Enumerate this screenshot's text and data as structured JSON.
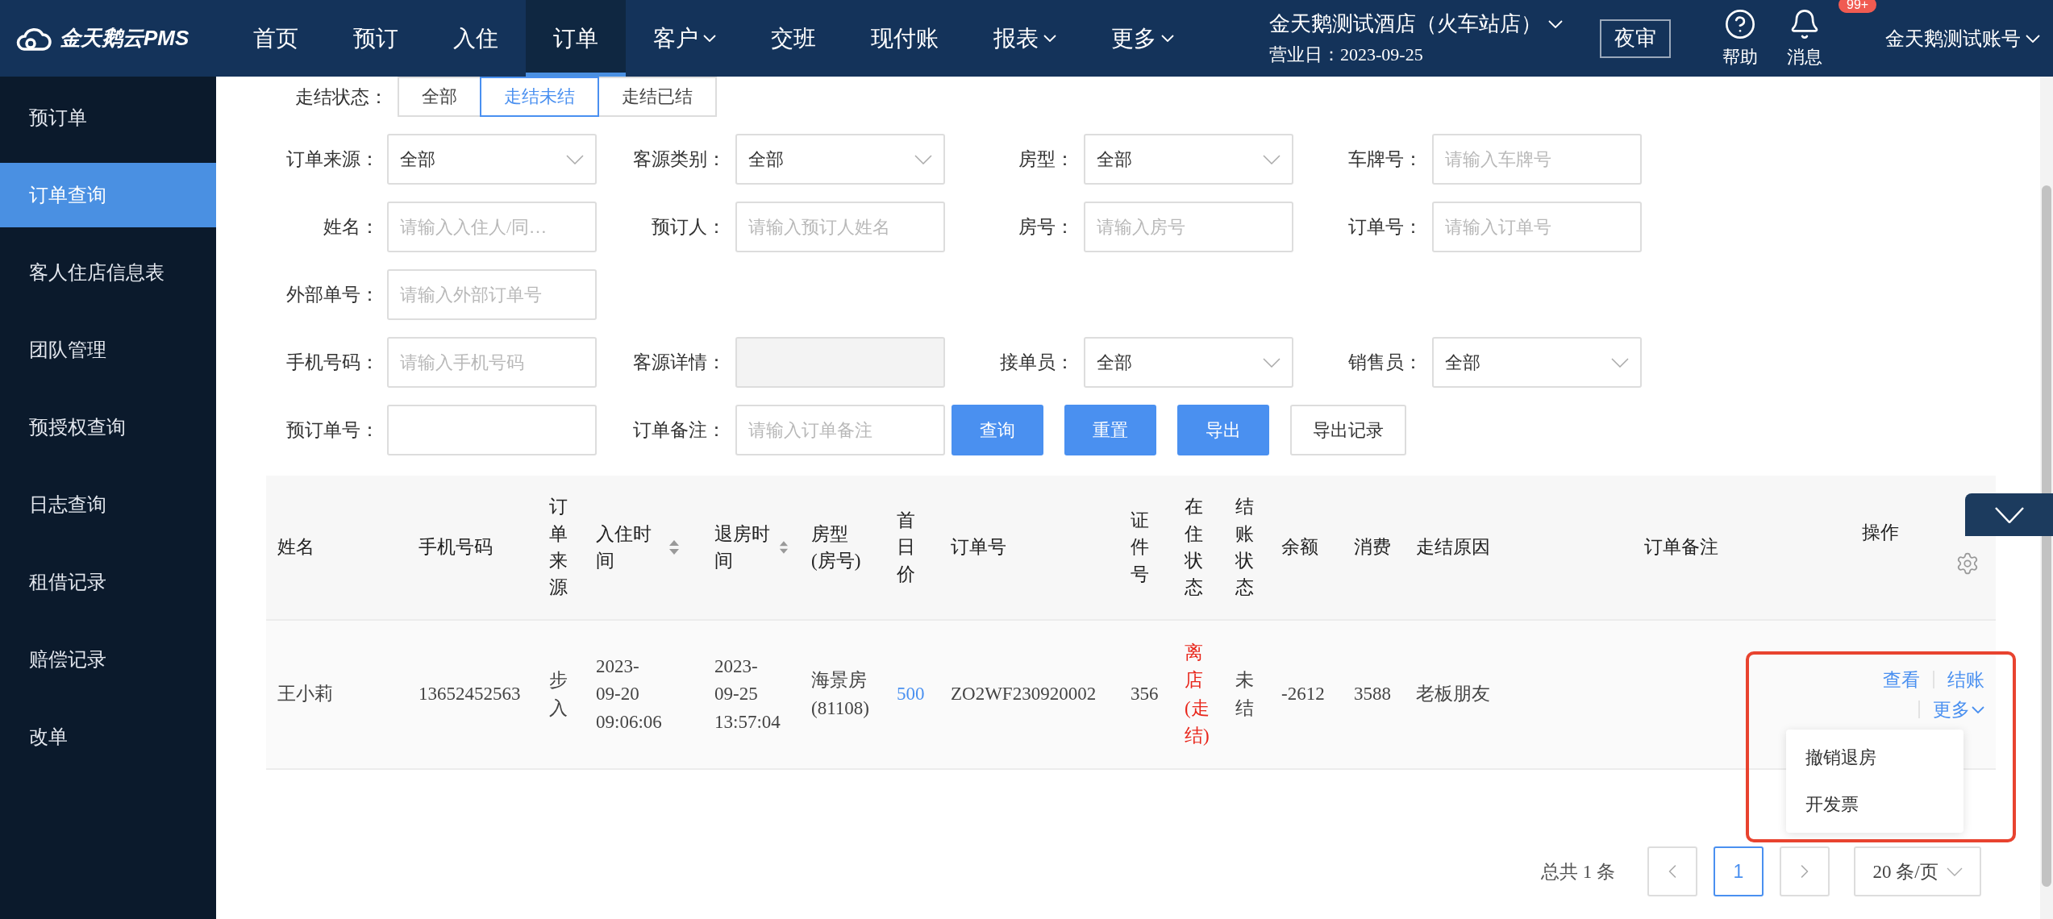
{
  "topbar": {
    "logo": "金天鹅云PMS",
    "nav": [
      {
        "label": "首页",
        "selected": false,
        "dropdown": false
      },
      {
        "label": "预订",
        "selected": false,
        "dropdown": false
      },
      {
        "label": "入住",
        "selected": false,
        "dropdown": false
      },
      {
        "label": "订单",
        "selected": true,
        "dropdown": false
      },
      {
        "label": "客户",
        "selected": false,
        "dropdown": true
      },
      {
        "label": "交班",
        "selected": false,
        "dropdown": false
      },
      {
        "label": "现付账",
        "selected": false,
        "dropdown": false
      },
      {
        "label": "报表",
        "selected": false,
        "dropdown": true
      },
      {
        "label": "更多",
        "selected": false,
        "dropdown": true
      }
    ],
    "hotel": {
      "name": "金天鹅测试酒店（火车站店）",
      "business_day": "营业日：2023-09-25"
    },
    "audit_button": "夜审",
    "help": "帮助",
    "messages": {
      "label": "消息",
      "badge": "99+"
    },
    "account": "金天鹅测试账号"
  },
  "sidebar": {
    "items": [
      {
        "label": "预订单",
        "selected": false
      },
      {
        "label": "订单查询",
        "selected": true
      },
      {
        "label": "客人住店信息表",
        "selected": false
      },
      {
        "label": "团队管理",
        "selected": false
      },
      {
        "label": "预授权查询",
        "selected": false
      },
      {
        "label": "日志查询",
        "selected": false
      },
      {
        "label": "租借记录",
        "selected": false
      },
      {
        "label": "赔偿记录",
        "selected": false
      },
      {
        "label": "改单",
        "selected": false
      }
    ]
  },
  "filters": {
    "status": {
      "label": "走结状态：",
      "options": [
        {
          "label": "全部",
          "selected": false
        },
        {
          "label": "走结未结",
          "selected": true
        },
        {
          "label": "走结已结",
          "selected": false
        }
      ]
    },
    "rows": [
      {
        "fields": [
          {
            "label": "订单来源：",
            "kind": "select",
            "value": "全部",
            "disabled": false
          },
          {
            "label": "客源类别：",
            "kind": "select",
            "value": "全部",
            "disabled": false
          },
          {
            "label": "房型：",
            "kind": "select",
            "value": "全部",
            "disabled": false
          },
          {
            "label": "车牌号：",
            "kind": "input",
            "placeholder": "请输入车牌号",
            "disabled": false
          }
        ]
      },
      {
        "fields": [
          {
            "label": "姓名：",
            "kind": "input",
            "placeholder": "请输入入住人/同…",
            "disabled": false
          },
          {
            "label": "预订人：",
            "kind": "input",
            "placeholder": "请输入预订人姓名",
            "disabled": false
          },
          {
            "label": "房号：",
            "kind": "input",
            "placeholder": "请输入房号",
            "disabled": false
          },
          {
            "label": "订单号：",
            "kind": "input",
            "placeholder": "请输入订单号",
            "disabled": false
          }
        ]
      },
      {
        "fields": [
          {
            "label": "外部单号：",
            "kind": "input",
            "placeholder": "请输入外部订单号",
            "disabled": false
          }
        ]
      },
      {
        "fields": [
          {
            "label": "手机号码：",
            "kind": "input",
            "placeholder": "请输入手机号码",
            "disabled": false
          },
          {
            "label": "客源详情：",
            "kind": "input",
            "disabled": true
          },
          {
            "label": "接单员：",
            "kind": "select",
            "value": "全部",
            "disabled": false
          },
          {
            "label": "销售员：",
            "kind": "select",
            "value": "全部",
            "disabled": false
          }
        ]
      },
      {
        "fields": [
          {
            "label": "预订单号：",
            "kind": "input",
            "disabled": false
          },
          {
            "label": "订单备注：",
            "kind": "input",
            "placeholder": "请输入订单备注",
            "disabled": false
          }
        ],
        "actions": [
          {
            "label": "查询",
            "kind": "primary"
          },
          {
            "label": "重置",
            "kind": "primary"
          },
          {
            "label": "导出",
            "kind": "primary"
          },
          {
            "label": "导出记录",
            "kind": "default"
          }
        ]
      }
    ]
  },
  "table": {
    "columns": [
      {
        "label": "姓名",
        "sortable": false
      },
      {
        "label": "手机号码",
        "sortable": false
      },
      {
        "label": "订单来源",
        "sortable": false
      },
      {
        "label": "入住时间",
        "sortable": true
      },
      {
        "label": "退房时间",
        "sortable": true
      },
      {
        "label": "房型(房号)",
        "sortable": false
      },
      {
        "label": "首日价",
        "sortable": false
      },
      {
        "label": "订单号",
        "sortable": false
      },
      {
        "label": "证件号",
        "sortable": false
      },
      {
        "label": "在住状态",
        "sortable": false
      },
      {
        "label": "结账状态",
        "sortable": false
      },
      {
        "label": "余额",
        "sortable": false
      },
      {
        "label": "消费",
        "sortable": false
      },
      {
        "label": "走结原因",
        "sortable": false
      },
      {
        "label": "订单备注",
        "sortable": false
      },
      {
        "label": "操作",
        "sortable": false
      }
    ],
    "rows": [
      {
        "cells": [
          {
            "text": "王小莉",
            "kind": "text"
          },
          {
            "text": "13652452563",
            "kind": "text"
          },
          {
            "text": "步入",
            "kind": "text"
          },
          {
            "text": "2023-09-20 09:06:06",
            "kind": "text"
          },
          {
            "text": "2023-09-25 13:57:04",
            "kind": "text"
          },
          {
            "text": "海景房(81108)",
            "kind": "text"
          },
          {
            "text": "500",
            "kind": "link"
          },
          {
            "text": "ZO2WF230920002",
            "kind": "text"
          },
          {
            "text": "356",
            "kind": "text"
          },
          {
            "text": "离店(走结)",
            "kind": "alert"
          },
          {
            "text": "未结",
            "kind": "text"
          },
          {
            "text": "-2612",
            "kind": "text"
          },
          {
            "text": "3588",
            "kind": "text"
          },
          {
            "text": "老板朋友",
            "kind": "text"
          }
        ],
        "actions": [
          {
            "label": "查看",
            "kind": "link"
          },
          {
            "label": "结账",
            "kind": "link"
          },
          {
            "label": "更多",
            "kind": "menu"
          }
        ],
        "menu": {
          "open": true,
          "items": [
            "撤销退房",
            "开发票"
          ]
        }
      }
    ]
  },
  "pagination": {
    "total": "总共 1 条",
    "pages": [
      {
        "label": "1",
        "selected": true
      }
    ],
    "page_size": "20 条/页"
  }
}
